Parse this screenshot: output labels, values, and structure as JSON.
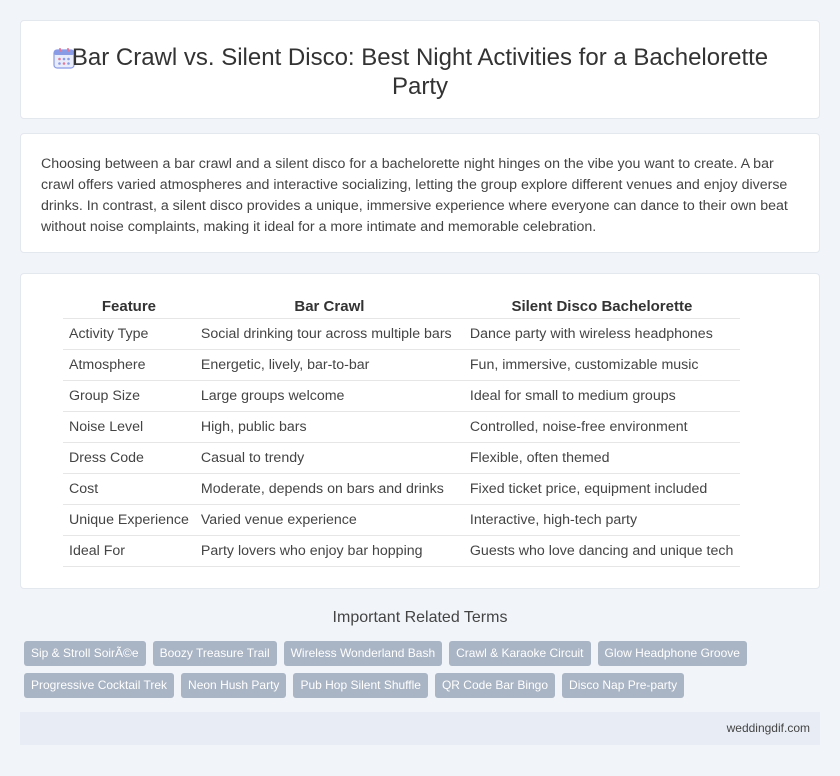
{
  "header": {
    "title": "Bar Crawl vs. Silent Disco: Best Night Activities for a Bachelorette Party",
    "icon": "calendar-icon"
  },
  "intro": {
    "text": "Choosing between a bar crawl and a silent disco for a bachelorette night hinges on the vibe you want to create. A bar crawl offers varied atmospheres and interactive socializing, letting the group explore different venues and enjoy diverse drinks. In contrast, a silent disco provides a unique, immersive experience where everyone can dance to their own beat without noise complaints, making it ideal for a more intimate and memorable celebration."
  },
  "table": {
    "headers": [
      "Feature",
      "Bar Crawl",
      "Silent Disco Bachelorette"
    ],
    "rows": [
      [
        "Activity Type",
        "Social drinking tour across multiple bars",
        "Dance party with wireless headphones"
      ],
      [
        "Atmosphere",
        "Energetic, lively, bar-to-bar",
        "Fun, immersive, customizable music"
      ],
      [
        "Group Size",
        "Large groups welcome",
        "Ideal for small to medium groups"
      ],
      [
        "Noise Level",
        "High, public bars",
        "Controlled, noise-free environment"
      ],
      [
        "Dress Code",
        "Casual to trendy",
        "Flexible, often themed"
      ],
      [
        "Cost",
        "Moderate, depends on bars and drinks",
        "Fixed ticket price, equipment included"
      ],
      [
        "Unique Experience",
        "Varied venue experience",
        "Interactive, high-tech party"
      ],
      [
        "Ideal For",
        "Party lovers who enjoy bar hopping",
        "Guests who love dancing and unique tech"
      ]
    ]
  },
  "related": {
    "title": "Important Related Terms",
    "tags": [
      "Sip & Stroll SoirÃ©e",
      "Boozy Treasure Trail",
      "Wireless Wonderland Bash",
      "Crawl & Karaoke Circuit",
      "Glow Headphone Groove",
      "Progressive Cocktail Trek",
      "Neon Hush Party",
      "Pub Hop Silent Shuffle",
      "QR Code Bar Bingo",
      "Disco Nap Pre-party"
    ]
  },
  "footer": {
    "site": "weddingdif.com"
  },
  "colors": {
    "background": "#f1f4f9",
    "tag": "#a9b4c4",
    "footer": "#e8edf5",
    "icon_accent": "#7b8fe0"
  }
}
